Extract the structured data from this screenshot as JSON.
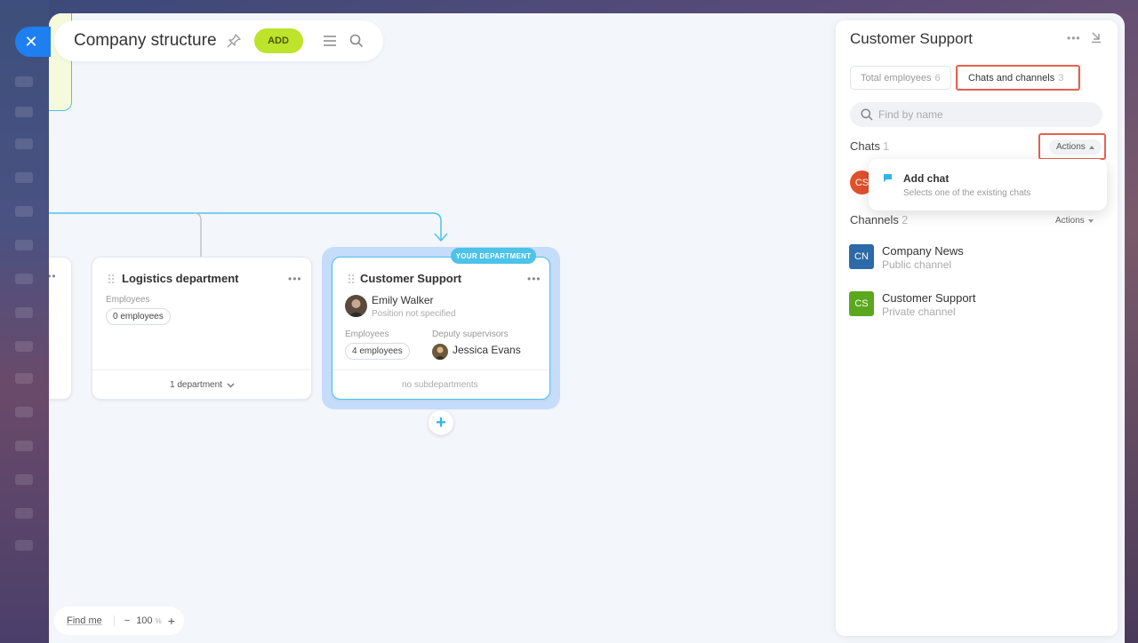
{
  "canvas": {
    "title": "Company structure",
    "add_label": "ADD",
    "bottom": {
      "find_me": "Find me",
      "zoom_minus": "−",
      "zoom_value": "100",
      "zoom_unit": "%",
      "zoom_plus": "+"
    }
  },
  "cards": {
    "logistics": {
      "title": "Logistics department",
      "employees_label": "Employees",
      "employees_count": "0 employees",
      "footer": "1 department"
    },
    "customer_support": {
      "badge": "YOUR DEPARTMENT",
      "title": "Customer Support",
      "head_name": "Emily Walker",
      "head_position": "Position not specified",
      "employees_label": "Employees",
      "employees_count": "4 employees",
      "deputy_label": "Deputy supervisors",
      "deputy_name": "Jessica Evans",
      "footer": "no subdepartments"
    }
  },
  "panel": {
    "title": "Customer Support",
    "tabs": [
      {
        "label": "Total employees",
        "count": "6"
      },
      {
        "label": "Chats and channels",
        "count": "3"
      }
    ],
    "search_placeholder": "Find by name",
    "chats": {
      "title": "Chats",
      "count": "1",
      "actions_label": "Actions",
      "items": [
        {
          "initials": "CS",
          "color": "#e0512c"
        }
      ]
    },
    "dropdown": {
      "title": "Add chat",
      "subtitle": "Selects one of the existing chats"
    },
    "channels": {
      "title": "Channels",
      "count": "2",
      "actions_label": "Actions",
      "items": [
        {
          "initials": "CN",
          "name": "Company News",
          "sub": "Public channel",
          "color": "#2d6aa8"
        },
        {
          "initials": "CS",
          "name": "Customer Support",
          "sub": "Private channel",
          "color": "#5ba81f"
        }
      ]
    }
  },
  "colors": {
    "accent": "#4cc3e8",
    "add_button": "#bde32a",
    "close_button": "#1e7ff0",
    "highlight": "#e8604c"
  }
}
